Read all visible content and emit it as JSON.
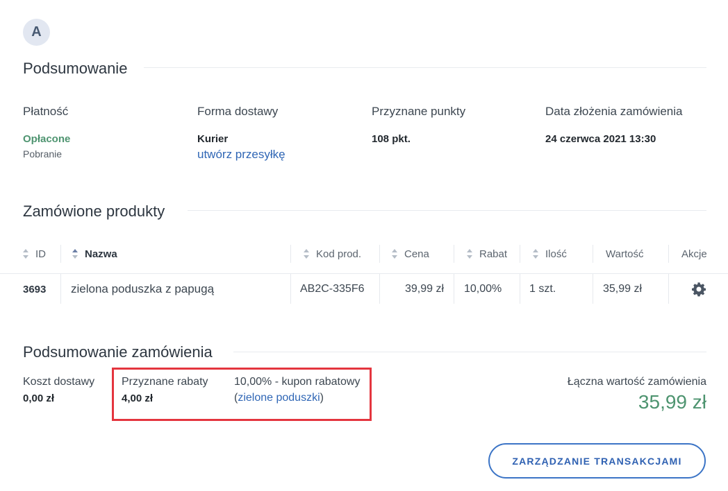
{
  "avatar": {
    "initial": "A"
  },
  "summary": {
    "title": "Podsumowanie",
    "payment_label": "Płatność",
    "payment_status": "Opłacone",
    "payment_method": "Pobranie",
    "delivery_label": "Forma dostawy",
    "delivery_value": "Kurier",
    "delivery_link": "utwórz przesyłkę",
    "points_label": "Przyznane punkty",
    "points_value": "108 pkt.",
    "date_label": "Data złożenia zamówienia",
    "date_value": "24 czerwca 2021 13:30"
  },
  "products": {
    "title": "Zamówione produkty",
    "columns": {
      "id": "ID",
      "name": "Nazwa",
      "code": "Kod prod.",
      "price": "Cena",
      "discount": "Rabat",
      "quantity": "Ilość",
      "value": "Wartość",
      "actions": "Akcje"
    },
    "rows": [
      {
        "id": "3693",
        "name": "zielona poduszka z papugą",
        "code": "AB2C-335F6",
        "price": "39,99 zł",
        "discount": "10,00%",
        "quantity": "1 szt.",
        "value": "35,99 zł",
        "action_icon": "gear-icon"
      }
    ]
  },
  "order_summary": {
    "title": "Podsumowanie zamówienia",
    "shipping_label": "Koszt dostawy",
    "shipping_value": "0,00 zł",
    "discounts_label": "Przyznane rabaty",
    "discounts_value": "4,00 zł",
    "coupon_text": "10,00% - kupon rabatowy",
    "coupon_paren_open": "(",
    "coupon_link": "zielone poduszki",
    "coupon_paren_close": ")",
    "total_label": "Łączna wartość zamówienia",
    "total_value": "35,99 zł"
  },
  "actions": {
    "manage_transactions": "ZARZĄDZANIE TRANSAKCJAMI"
  },
  "colors": {
    "accent": "#2f66b5",
    "success": "#4e9470",
    "highlight": "#e4353e"
  }
}
